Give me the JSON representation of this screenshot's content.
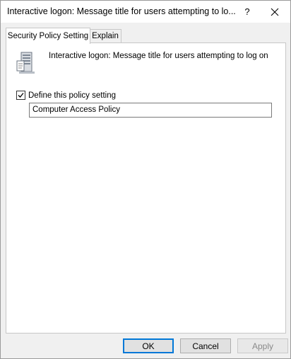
{
  "window": {
    "title": "Interactive logon: Message title for users attempting to lo...",
    "help_label": "?",
    "close_icon": "close-icon"
  },
  "tabs": [
    {
      "label": "Security Policy Setting",
      "active": true
    },
    {
      "label": "Explain",
      "active": false
    }
  ],
  "policy": {
    "icon": "server-policy-icon",
    "title": "Interactive logon: Message title for users attempting to log on",
    "define_checkbox": {
      "label": "Define this policy setting",
      "checked": true
    },
    "value": "Computer Access Policy"
  },
  "buttons": {
    "ok": "OK",
    "cancel": "Cancel",
    "apply": "Apply"
  },
  "colors": {
    "accent": "#0078d7",
    "window_bg": "#f0f0f0",
    "panel_bg": "#ffffff"
  }
}
